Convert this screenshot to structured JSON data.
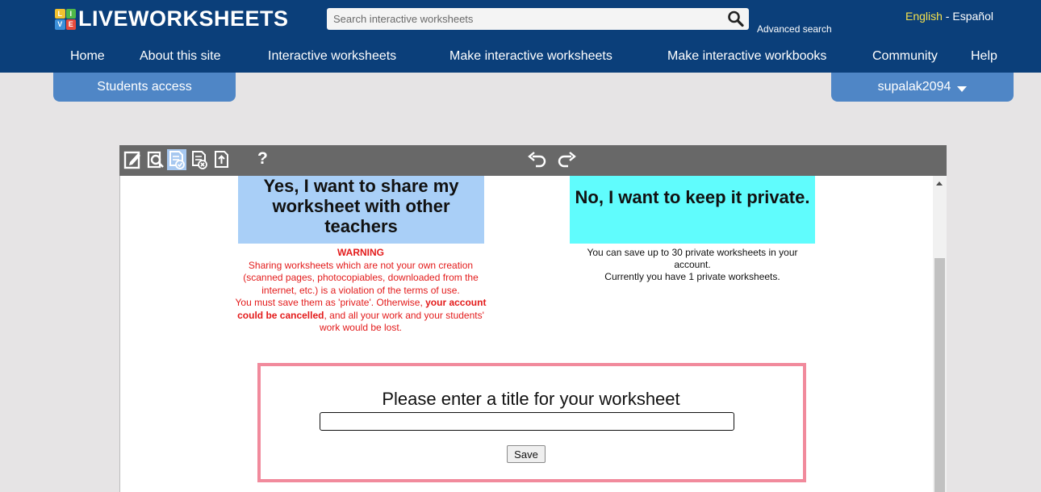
{
  "header": {
    "logo_badge_letters": [
      "L",
      "I",
      "V",
      "E"
    ],
    "logo_text": "LIVEWORKSHEETS",
    "search_placeholder": "Search interactive worksheets",
    "advanced_search": "Advanced search",
    "lang_english": "English",
    "lang_separator": " - ",
    "lang_spanish": "Español"
  },
  "nav": [
    "Home",
    "About this site",
    "Interactive worksheets",
    "Make interactive worksheets",
    "Make interactive workbooks",
    "Community",
    "Help"
  ],
  "tabs": {
    "students": "Students access",
    "user": "supalak2094"
  },
  "toolbar": {
    "icons": [
      "edit-icon",
      "preview-icon",
      "save-check-icon",
      "delete-icon",
      "upload-icon"
    ],
    "active_icon": "save-check-icon",
    "help": "?"
  },
  "share": {
    "yes_title": "Yes, I want to share my worksheet with other teachers",
    "no_title": "No, I want to keep it private.",
    "warning_title": "WARNING",
    "warning_body": "Sharing worksheets which are not your own creation (scanned pages, photocopiables, downloaded from the internet, etc.) is a violation of the terms of use.",
    "warning_line2": "You must save them as 'private'. Otherwise, ",
    "warning_bold": "your account could be cancelled",
    "warning_line3": ", and all your work and your students' work would be lost.",
    "private_line1": "You can save up to 30 private worksheets in your account.",
    "private_line2": "Currently you have 1 private worksheets."
  },
  "title_form": {
    "label": "Please enter a title for your worksheet",
    "value": "",
    "save": "Save"
  },
  "colors": {
    "header_bg": "#0b3f7a",
    "tab_bg": "#4f86c6",
    "share_bg": "#a9cff7",
    "private_bg": "#60fcfd",
    "warning": "#e31b1b",
    "title_border": "#f18a9c"
  }
}
